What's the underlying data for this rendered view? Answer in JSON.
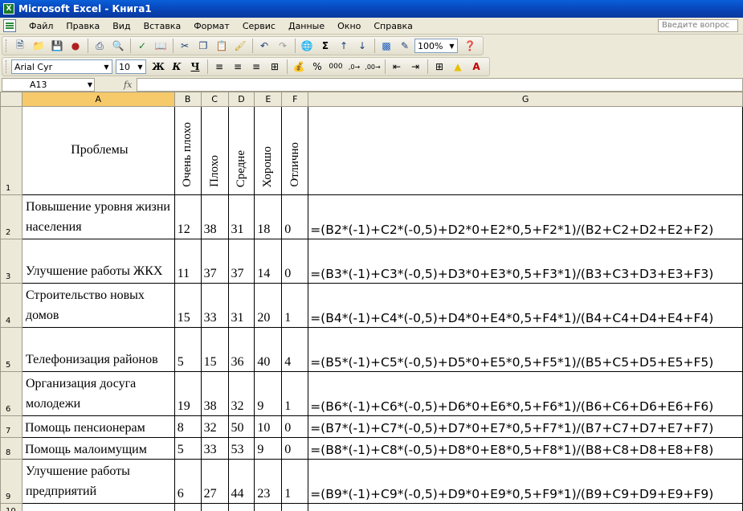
{
  "window": {
    "title": "Microsoft Excel - Книга1",
    "app_icon": "X"
  },
  "menu": {
    "items": [
      "Файл",
      "Правка",
      "Вид",
      "Вставка",
      "Формат",
      "Сервис",
      "Данные",
      "Окно",
      "Справка"
    ],
    "help_placeholder": "Введите вопрос"
  },
  "toolbar": {
    "zoom": "100%",
    "font_name": "Arial Cyr",
    "font_size": "10",
    "bold": "Ж",
    "italic": "К",
    "underline": "Ч"
  },
  "formula_bar": {
    "name_box": "A13",
    "fx": "fx",
    "value": ""
  },
  "sheet": {
    "columns": [
      "A",
      "B",
      "C",
      "D",
      "E",
      "F",
      "G"
    ],
    "selected_column": "A",
    "header_row": {
      "row": "1",
      "title": "Проблемы",
      "ratings": [
        "Очень плохо",
        "Плохо",
        "Средне",
        "Хорошо",
        "Отлично"
      ]
    },
    "rows": [
      {
        "n": "2",
        "name": "Повышение уровня жизни населения",
        "vals": [
          "12",
          "38",
          "31",
          "18",
          "0"
        ],
        "formula": "=(B2*(-1)+C2*(-0,5)+D2*0+E2*0,5+F2*1)/(B2+C2+D2+E2+F2)"
      },
      {
        "n": "3",
        "name": "Улучшение работы ЖКХ",
        "vals": [
          "11",
          "37",
          "37",
          "14",
          "0"
        ],
        "formula": "=(B3*(-1)+C3*(-0,5)+D3*0+E3*0,5+F3*1)/(B3+C3+D3+E3+F3)"
      },
      {
        "n": "4",
        "name": "Строительство новых домов",
        "vals": [
          "15",
          "33",
          "31",
          "20",
          "1"
        ],
        "formula": "=(B4*(-1)+C4*(-0,5)+D4*0+E4*0,5+F4*1)/(B4+C4+D4+E4+F4)"
      },
      {
        "n": "5",
        "name": "Телефонизация районов",
        "vals": [
          "5",
          "15",
          "36",
          "40",
          "4"
        ],
        "formula": "=(B5*(-1)+C5*(-0,5)+D5*0+E5*0,5+F5*1)/(B5+C5+D5+E5+F5)"
      },
      {
        "n": "6",
        "name": "Организация досуга молодежи",
        "vals": [
          "19",
          "38",
          "32",
          "9",
          "1"
        ],
        "formula": "=(B6*(-1)+C6*(-0,5)+D6*0+E6*0,5+F6*1)/(B6+C6+D6+E6+F6)"
      },
      {
        "n": "7",
        "name": "Помощь пенсионерам",
        "vals": [
          "8",
          "32",
          "50",
          "10",
          "0"
        ],
        "formula": "=(B7*(-1)+C7*(-0,5)+D7*0+E7*0,5+F7*1)/(B7+C7+D7+E7+F7)"
      },
      {
        "n": "8",
        "name": "Помощь малоимущим",
        "vals": [
          "5",
          "33",
          "53",
          "9",
          "0"
        ],
        "formula": "=(B8*(-1)+C8*(-0,5)+D8*0+E8*0,5+F8*1)/(B8+C8+D8+E8+F8)"
      },
      {
        "n": "9",
        "name": "Улучшение работы предприятий",
        "vals": [
          "6",
          "27",
          "44",
          "23",
          "1"
        ],
        "formula": "=(B9*(-1)+C9*(-0,5)+D9*0+E9*0,5+F9*1)/(B9+C9+D9+E9+F9)"
      }
    ],
    "next_row": "10"
  }
}
